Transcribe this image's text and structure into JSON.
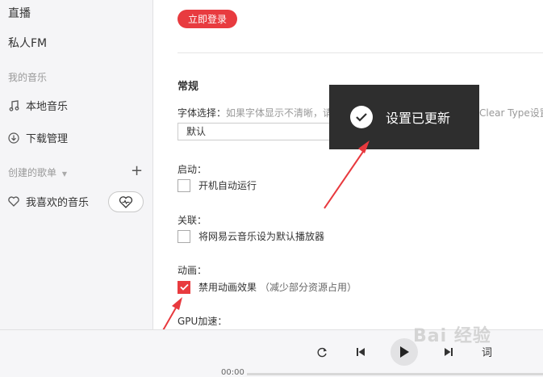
{
  "sidebar": {
    "items_top": [
      "直播",
      "私人FM"
    ],
    "my_music_title": "我的音乐",
    "local_music": "本地音乐",
    "download_mgmt": "下载管理",
    "created_playlists_title": "创建的歌单",
    "favorite_music": "我喜欢的音乐"
  },
  "main": {
    "login_label": "立即登录",
    "section_title": "常规",
    "font_label": "字体选择：",
    "font_hint": "如果字体显示不清晰，请在",
    "font_hint_right": "Clear Type设置",
    "font_select_value": "默认",
    "startup_label": "启动：",
    "startup_option": "开机自动运行",
    "startup_checked": false,
    "assoc_label": "关联：",
    "assoc_option": "将网易云音乐设为默认播放器",
    "assoc_checked": false,
    "animation_label": "动画：",
    "animation_option": "禁用动画效果",
    "animation_sub": "（减少部分资源占用）",
    "animation_checked": true,
    "gpu_label": "GPU加速："
  },
  "toast": {
    "text": "设置已更新"
  },
  "player": {
    "time": "00:00",
    "lyric_button": "词"
  },
  "watermark": "Bai 经验",
  "colors": {
    "accent": "#e83b3f",
    "toast_bg": "#2e2e2e",
    "arrow": "#e8393e"
  }
}
